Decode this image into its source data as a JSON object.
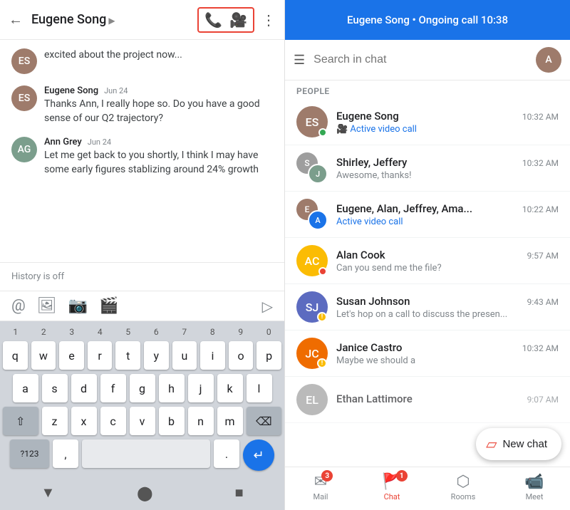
{
  "left": {
    "header": {
      "contact": "Eugene Song",
      "phone_icon": "📞",
      "video_icon": "🎥",
      "more_icon": "⋮"
    },
    "messages": [
      {
        "sender": "Eugene Song",
        "date": "Jun 24",
        "text": "excited about the project now...",
        "avatar_initials": "ES",
        "avatar_class": "eugene"
      },
      {
        "sender": "Eugene Song",
        "date": "Jun 24",
        "text": "Thanks Ann, I really hope so. Do you have a good sense of our Q2 trajectory?",
        "avatar_initials": "ES",
        "avatar_class": "eugene"
      },
      {
        "sender": "Ann Grey",
        "date": "Jun 24",
        "text": "Let me get back to you shortly, I think I may have some early figures stablizing around 24% growth",
        "avatar_initials": "AG",
        "avatar_class": "ann"
      }
    ],
    "history_off": "History is off",
    "toolbar_icons": [
      "@",
      "🖼",
      "📷",
      "🎥+"
    ],
    "keyboard": {
      "numbers": [
        "1",
        "2",
        "3",
        "4",
        "5",
        "6",
        "7",
        "8",
        "9",
        "0"
      ],
      "row1": [
        "q",
        "w",
        "e",
        "r",
        "t",
        "y",
        "u",
        "i",
        "o",
        "p"
      ],
      "row2": [
        "a",
        "s",
        "d",
        "f",
        "g",
        "h",
        "j",
        "k",
        "l"
      ],
      "row3": [
        "z",
        "x",
        "c",
        "v",
        "b",
        "n",
        "m"
      ],
      "special1": "?123",
      "space": " ",
      "period": "."
    },
    "bottom_nav": [
      "▼",
      "⬤",
      "■"
    ]
  },
  "right": {
    "header_title": "Eugene Song • Ongoing call 10:38",
    "search_placeholder": "Search in chat",
    "section_label": "PEOPLE",
    "chats": [
      {
        "name": "Eugene Song",
        "time": "10:32 AM",
        "preview": "Active video call",
        "has_online": true,
        "has_video_icon": true,
        "avatar_initials": "ES",
        "avatar_bg": "#9e7b6b"
      },
      {
        "name": "Shirley, Jeffery",
        "time": "10:32 AM",
        "preview": "Awesome, thanks!",
        "has_online": false,
        "has_video_icon": false,
        "avatar_initials": "SJ",
        "avatar_bg": "#7b9e8c",
        "is_dual": true,
        "av1_bg": "#7b9e8c",
        "av2_bg": "#9e7b6b"
      },
      {
        "name": "Eugene, Alan, Jeffrey, Ama...",
        "time": "10:22 AM",
        "preview": "Active video call",
        "has_online": false,
        "has_video_icon": true,
        "is_group": true,
        "av1_bg": "#9e7b6b",
        "av2_bg": "#1a73e8"
      },
      {
        "name": "Alan Cook",
        "time": "9:57 AM",
        "preview": "Can you send me the file?",
        "has_busy": true,
        "avatar_initials": "AC",
        "avatar_bg": "#fbbc04"
      },
      {
        "name": "Susan Johnson",
        "time": "9:43 AM",
        "preview": "Let's hop on a call to discuss the presen...",
        "has_warning": true,
        "avatar_initials": "SJ",
        "avatar_bg": "#5c6bc0"
      },
      {
        "name": "Janice Castro",
        "time": "10:32 AM",
        "preview": "Maybe we should a",
        "has_warning": true,
        "avatar_initials": "JC",
        "avatar_bg": "#ef6c00"
      },
      {
        "name": "Ethan Lattimore",
        "time": "9:07 AM",
        "preview": "",
        "avatar_initials": "EL",
        "avatar_bg": "#9e9e9e"
      }
    ],
    "new_chat_label": "New chat",
    "bottom_nav": [
      {
        "icon": "✉",
        "label": "Mail",
        "badge": "3",
        "active": false
      },
      {
        "icon": "🚩",
        "label": "Chat",
        "badge": "1",
        "active": true
      },
      {
        "icon": "⬡",
        "label": "Rooms",
        "badge": "",
        "active": false
      },
      {
        "icon": "📹",
        "label": "Meet",
        "badge": "",
        "active": false
      }
    ]
  }
}
